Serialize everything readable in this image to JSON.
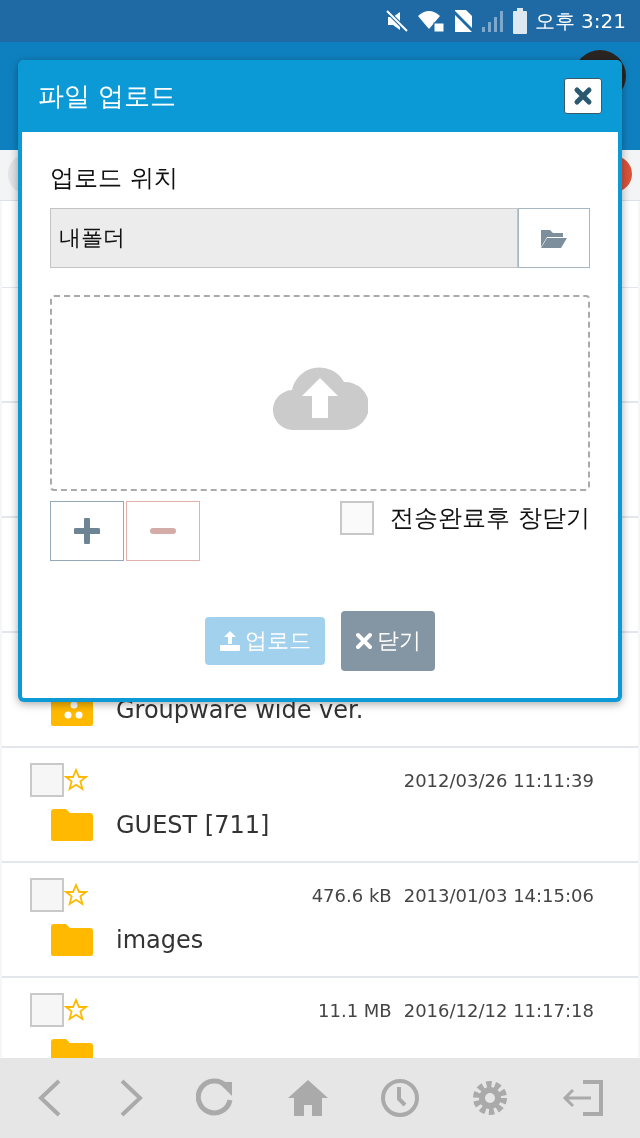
{
  "status_bar": {
    "time": "오후 3:21"
  },
  "dialog": {
    "title": "파일 업로드",
    "location_label": "업로드 위치",
    "location_value": "내폴더",
    "close_after": {
      "label": "전송완료후 창닫기",
      "checked": false
    },
    "buttons": [
      {
        "kind": "upload",
        "label": "업로드",
        "disabled": true
      },
      {
        "kind": "close",
        "label": "닫기",
        "disabled": false
      }
    ]
  },
  "rows": [
    {
      "kind": "app",
      "name": "Groupware wide ver."
    },
    {
      "kind": "folder",
      "checked": false,
      "starred": false,
      "date": "2012/03/26 11:11:39",
      "name": "GUEST [711]"
    },
    {
      "kind": "folder",
      "checked": false,
      "starred": false,
      "size": "476.6 kB",
      "date": "2013/01/03 14:15:06",
      "name": "images"
    },
    {
      "kind": "folder",
      "checked": false,
      "starred": false,
      "size": "11.1 MB",
      "date": "2016/12/12 11:17:18"
    }
  ]
}
